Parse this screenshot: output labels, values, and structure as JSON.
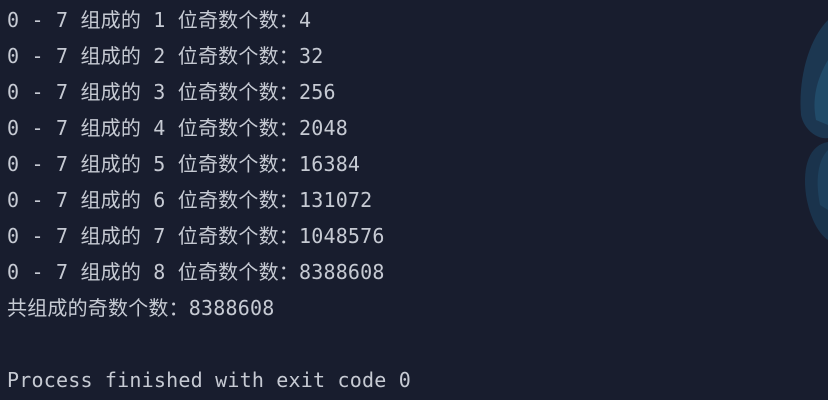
{
  "console": {
    "lines": [
      "0 - 7 组成的 1 位奇数个数：4",
      "0 - 7 组成的 2 位奇数个数：32",
      "0 - 7 组成的 3 位奇数个数：256",
      "0 - 7 组成的 4 位奇数个数：2048",
      "0 - 7 组成的 5 位奇数个数：16384",
      "0 - 7 组成的 6 位奇数个数：131072",
      "0 - 7 组成的 7 位奇数个数：1048576",
      "0 - 7 组成的 8 位奇数个数：8388608",
      "共组成的奇数个数：8388608",
      "",
      "Process finished with exit code 0"
    ]
  },
  "colors": {
    "background": "#181d2e",
    "text": "#c6cad3",
    "art": "#1f4a66"
  }
}
